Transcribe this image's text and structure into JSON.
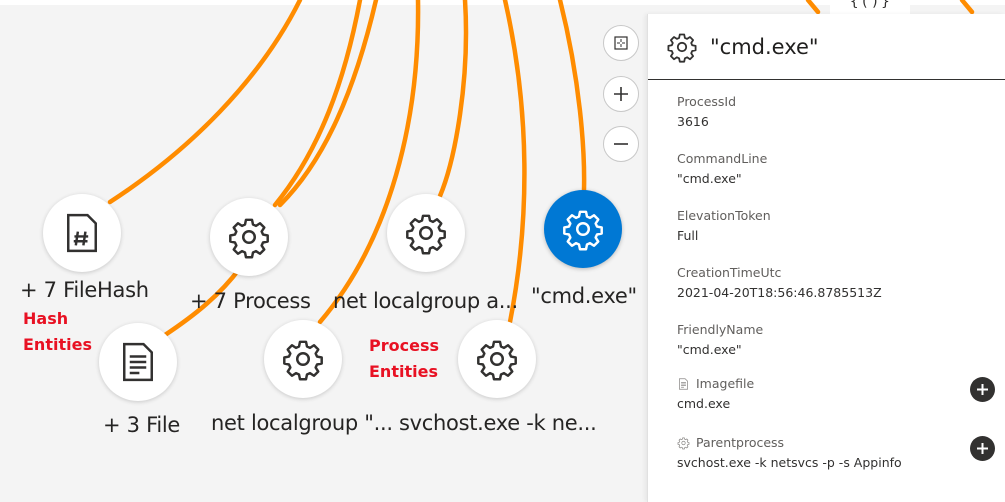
{
  "graph": {
    "edge_color": "#ff8c00",
    "selected_color": "#0078d4",
    "nodes": [
      {
        "id": "filehash-group",
        "label": "+ 7 FileHash",
        "icon": "file-hash-icon",
        "stacked": true,
        "selected": false
      },
      {
        "id": "process-group",
        "label": "+ 7 Process",
        "icon": "gear-icon",
        "stacked": true,
        "selected": false
      },
      {
        "id": "net-localgroup-a",
        "label": "net localgroup a...",
        "icon": "gear-icon",
        "stacked": false,
        "selected": false
      },
      {
        "id": "cmd-exe",
        "label": "\"cmd.exe\"",
        "icon": "gear-icon",
        "stacked": false,
        "selected": true
      },
      {
        "id": "file-group",
        "label": "+ 3 File",
        "icon": "file-icon",
        "stacked": true,
        "selected": false
      },
      {
        "id": "net-localgroup-quote",
        "label": "net localgroup \"...",
        "icon": "gear-icon",
        "stacked": false,
        "selected": false
      },
      {
        "id": "svchost",
        "label": "svchost.exe -k ne...",
        "icon": "gear-icon",
        "stacked": false,
        "selected": false
      }
    ],
    "annotations": {
      "hash": [
        "Hash",
        "Entities"
      ],
      "process": [
        "Process",
        "Entities"
      ]
    },
    "peek_node_glyph": "{()}"
  },
  "zoom_controls": {
    "fit": "fit-to-screen-icon",
    "zoom_in": "zoom-in-icon",
    "zoom_out": "zoom-out-icon"
  },
  "details_panel": {
    "title": "\"cmd.exe\"",
    "icon": "gear-icon",
    "fields": [
      {
        "label": "ProcessId",
        "value": "3616"
      },
      {
        "label": "CommandLine",
        "value": "\"cmd.exe\""
      },
      {
        "label": "ElevationToken",
        "value": "Full"
      },
      {
        "label": "CreationTimeUtc",
        "value": "2021-04-20T18:56:46.8785513Z"
      },
      {
        "label": "FriendlyName",
        "value": "\"cmd.exe\""
      }
    ],
    "linked_entities": [
      {
        "label": "Imagefile",
        "value": "cmd.exe",
        "icon": "file-icon",
        "action": "add-to-graph"
      },
      {
        "label": "Parentprocess",
        "value": "svchost.exe -k netsvcs -p -s Appinfo",
        "icon": "gear-icon",
        "action": "add-to-graph"
      }
    ]
  }
}
